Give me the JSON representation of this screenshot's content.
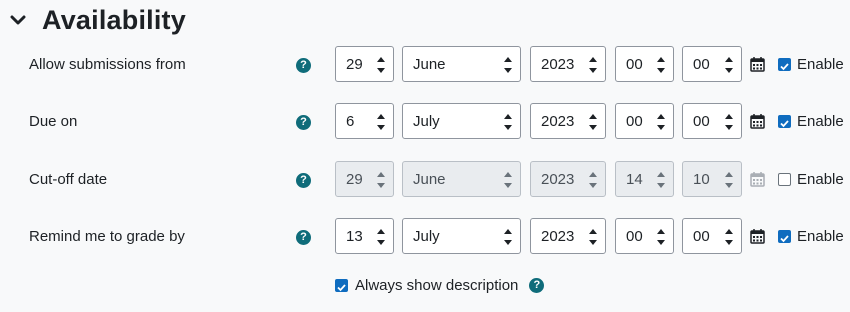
{
  "section": {
    "title": "Availability",
    "toggle_icon": "chevron-down-icon"
  },
  "help_glyph": "?",
  "rows": [
    {
      "label": "Allow submissions from",
      "day": "29",
      "month": "June",
      "year": "2023",
      "hour": "00",
      "minute": "00",
      "enabled": true,
      "enable_label": "Enable"
    },
    {
      "label": "Due on",
      "day": "6",
      "month": "July",
      "year": "2023",
      "hour": "00",
      "minute": "00",
      "enabled": true,
      "enable_label": "Enable"
    },
    {
      "label": "Cut-off date",
      "day": "29",
      "month": "June",
      "year": "2023",
      "hour": "14",
      "minute": "10",
      "enabled": false,
      "enable_label": "Enable"
    },
    {
      "label": "Remind me to grade by",
      "day": "13",
      "month": "July",
      "year": "2023",
      "hour": "00",
      "minute": "00",
      "enabled": true,
      "enable_label": "Enable"
    }
  ],
  "always_show": {
    "label": "Always show description",
    "checked": true
  },
  "colors": {
    "accent": "#0f6cbf",
    "help_icon": "#0f6c7a",
    "background": "#f8f9fa"
  }
}
